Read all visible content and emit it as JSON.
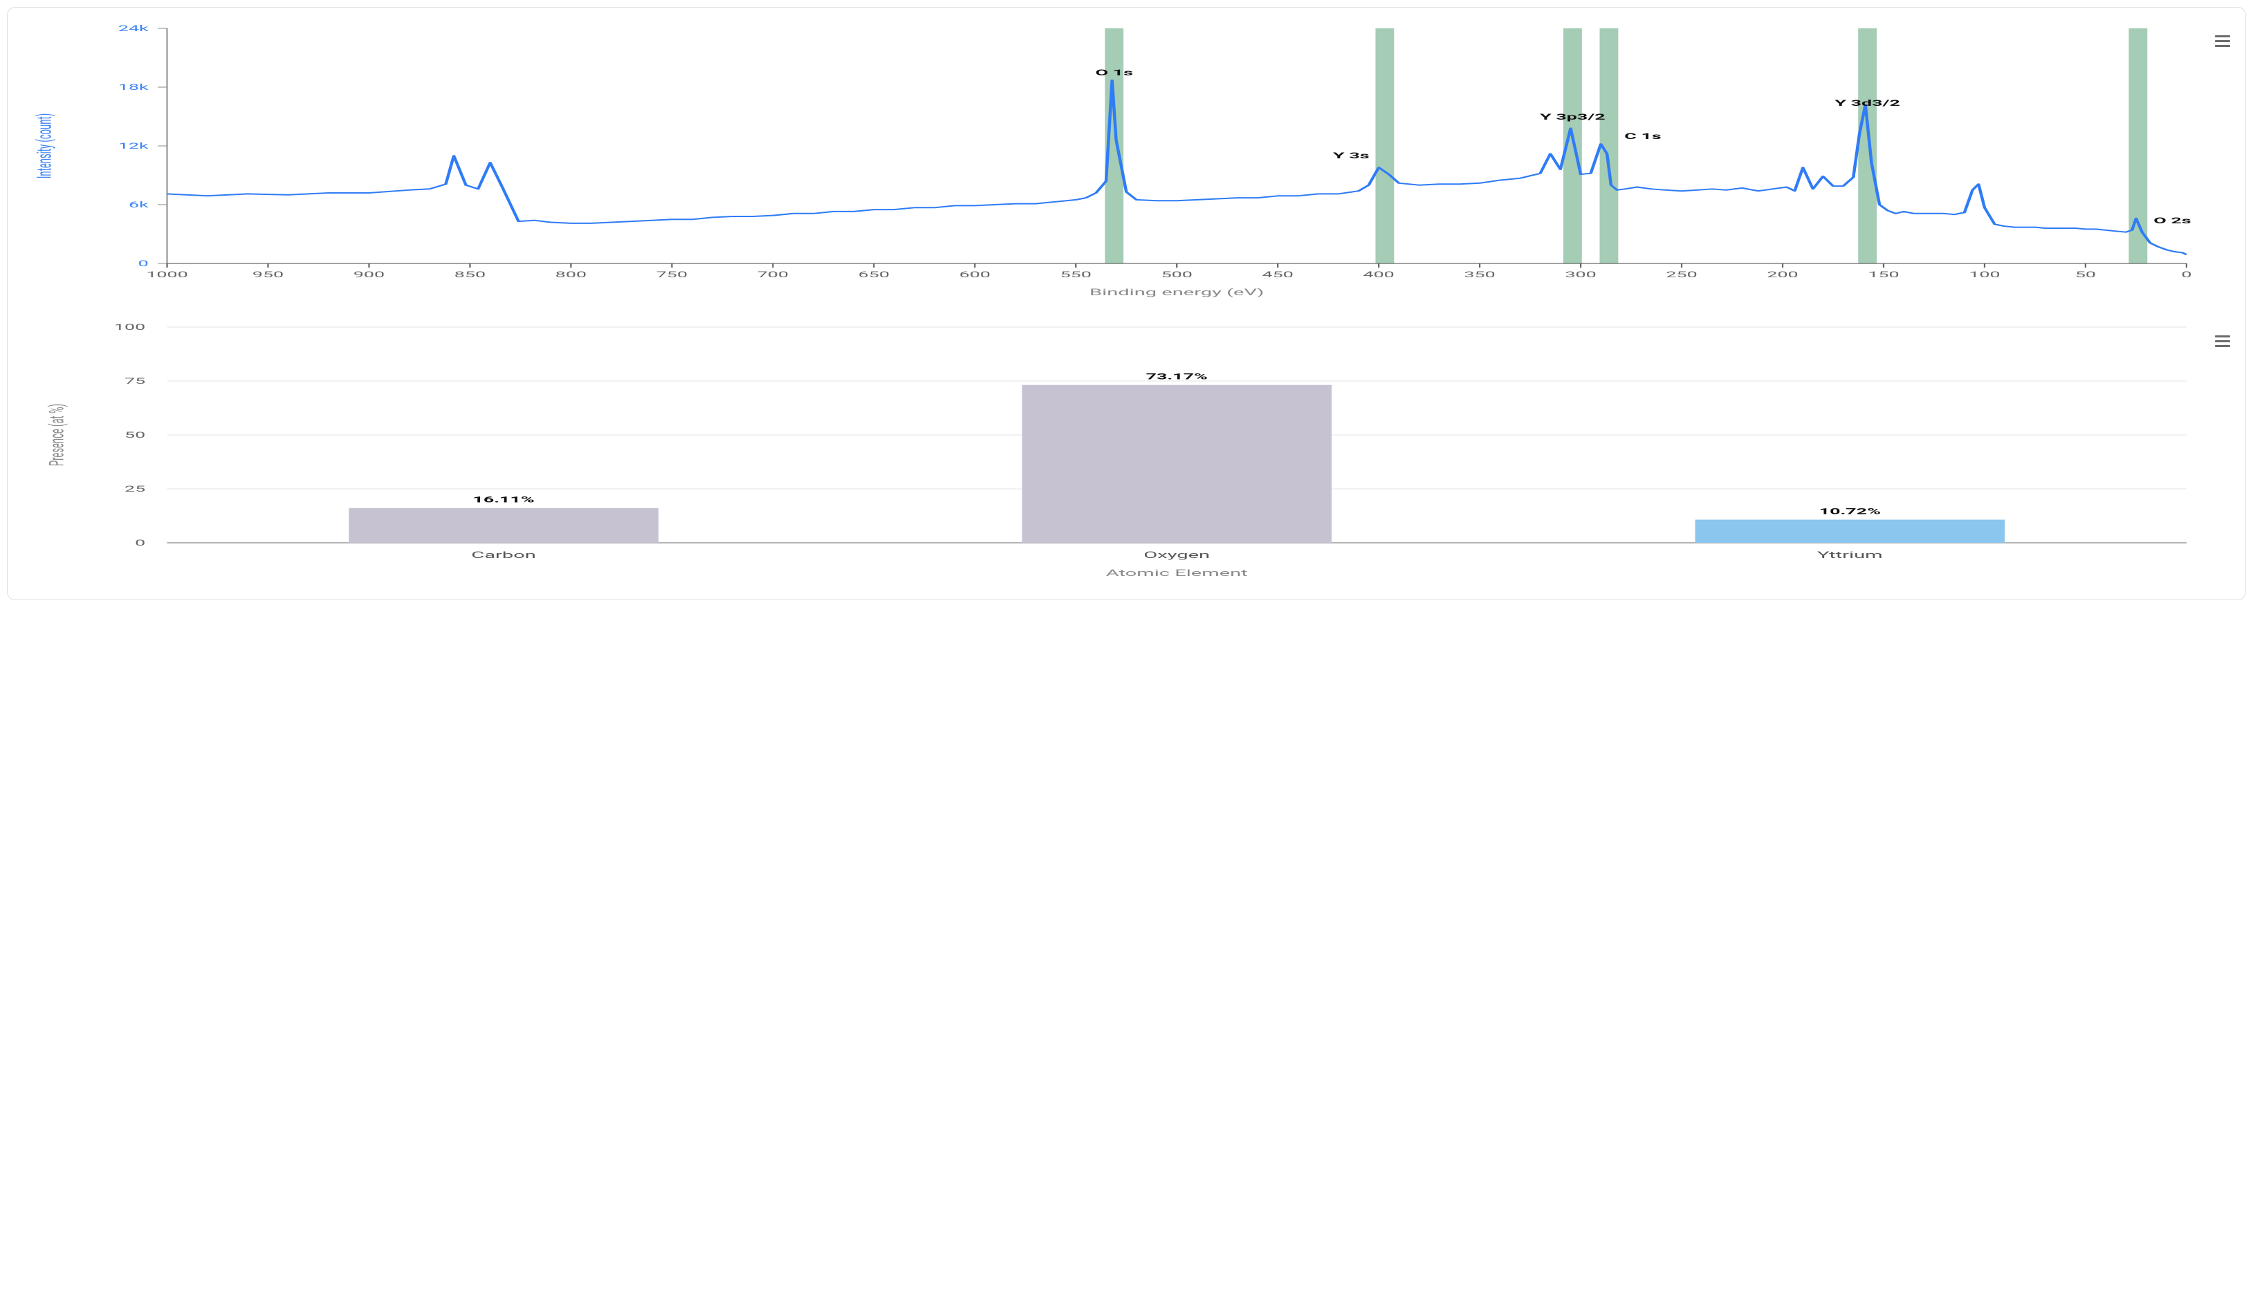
{
  "chart_data": [
    {
      "type": "line",
      "xlabel": "Binding energy (eV)",
      "ylabel": "Intensity (count)",
      "xlim": [
        1000,
        0
      ],
      "ylim": [
        0,
        24000
      ],
      "x_ticks": [
        1000,
        950,
        900,
        850,
        800,
        750,
        700,
        650,
        600,
        550,
        500,
        450,
        400,
        350,
        300,
        250,
        200,
        150,
        100,
        50,
        0
      ],
      "x_tick_labels": [
        "1000",
        "950",
        "900",
        "850",
        "800",
        "750",
        "700",
        "650",
        "600",
        "550",
        "500",
        "450",
        "400",
        "350",
        "300",
        "250",
        "200",
        "150",
        "100",
        "50",
        "0"
      ],
      "y_ticks": [
        0,
        6000,
        12000,
        18000,
        24000
      ],
      "y_tick_labels": [
        "0",
        "6k",
        "12k",
        "18k",
        "24k"
      ],
      "bands": [
        {
          "x": 531,
          "label": "O 1s"
        },
        {
          "x": 397,
          "label": "Y 3s"
        },
        {
          "x": 304,
          "label": "Y 3p3/2"
        },
        {
          "x": 286,
          "label": "C 1s"
        },
        {
          "x": 158,
          "label": "Y 3d3/2"
        },
        {
          "x": 24,
          "label": "O 2s"
        }
      ],
      "series": [
        {
          "name": "Intensity",
          "color": "#2f7cf6",
          "x": [
            1000,
            980,
            960,
            940,
            920,
            900,
            880,
            870,
            862,
            858,
            852,
            846,
            840,
            834,
            826,
            818,
            810,
            800,
            790,
            780,
            770,
            760,
            750,
            740,
            730,
            720,
            710,
            700,
            690,
            680,
            670,
            660,
            650,
            640,
            630,
            620,
            610,
            600,
            590,
            580,
            570,
            560,
            550,
            545,
            540,
            535,
            532,
            530,
            525,
            520,
            510,
            500,
            490,
            480,
            470,
            460,
            450,
            440,
            430,
            420,
            410,
            405,
            400,
            395,
            390,
            380,
            370,
            360,
            350,
            340,
            330,
            320,
            315,
            310,
            305,
            302,
            300,
            295,
            290,
            287,
            285,
            282,
            278,
            272,
            265,
            258,
            250,
            242,
            235,
            228,
            220,
            212,
            205,
            198,
            194,
            190,
            185,
            180,
            175,
            170,
            165,
            162,
            159,
            156,
            152,
            148,
            144,
            140,
            135,
            130,
            125,
            120,
            115,
            110,
            106,
            103,
            100,
            95,
            90,
            85,
            80,
            75,
            70,
            65,
            60,
            55,
            50,
            45,
            40,
            35,
            30,
            27,
            25,
            22,
            18,
            14,
            10,
            6,
            2,
            0
          ],
          "y": [
            7100,
            6900,
            7100,
            7000,
            7200,
            7200,
            7500,
            7600,
            8100,
            11000,
            8000,
            7600,
            10300,
            7800,
            4300,
            4400,
            4200,
            4100,
            4100,
            4200,
            4300,
            4400,
            4500,
            4500,
            4700,
            4800,
            4800,
            4900,
            5100,
            5100,
            5300,
            5300,
            5500,
            5500,
            5700,
            5700,
            5900,
            5900,
            6000,
            6100,
            6100,
            6300,
            6500,
            6700,
            7200,
            8400,
            18700,
            12600,
            7300,
            6500,
            6400,
            6400,
            6500,
            6600,
            6700,
            6700,
            6900,
            6900,
            7100,
            7100,
            7400,
            8000,
            9800,
            9100,
            8200,
            8000,
            8100,
            8100,
            8200,
            8500,
            8700,
            9200,
            11200,
            9600,
            13800,
            11000,
            9100,
            9200,
            12200,
            11200,
            8000,
            7500,
            7600,
            7800,
            7600,
            7500,
            7400,
            7500,
            7600,
            7500,
            7700,
            7400,
            7600,
            7800,
            7400,
            9800,
            7600,
            8900,
            7900,
            7900,
            8800,
            13200,
            16200,
            10300,
            6000,
            5400,
            5100,
            5300,
            5100,
            5100,
            5100,
            5100,
            5000,
            5200,
            7500,
            8100,
            5700,
            4000,
            3800,
            3700,
            3700,
            3700,
            3600,
            3600,
            3600,
            3600,
            3500,
            3500,
            3400,
            3300,
            3200,
            3400,
            4600,
            3200,
            2100,
            1700,
            1400,
            1200,
            1100,
            900
          ]
        }
      ]
    },
    {
      "type": "bar",
      "xlabel": "Atomic Element",
      "ylabel": "Presence (at %)",
      "ylim": [
        0,
        100
      ],
      "y_ticks": [
        0,
        25,
        50,
        75,
        100
      ],
      "y_tick_labels": [
        "0",
        "25",
        "50",
        "75",
        "100"
      ],
      "categories": [
        "Carbon",
        "Oxygen",
        "Yttrium"
      ],
      "series": [
        {
          "name": "Presence",
          "values": [
            16.11,
            73.17,
            10.72
          ],
          "colors": [
            "#c6c2d1",
            "#c6c2d1",
            "#8bc6ee"
          ],
          "value_labels": [
            "16.11%",
            "73.17%",
            "10.72%"
          ]
        }
      ]
    }
  ]
}
